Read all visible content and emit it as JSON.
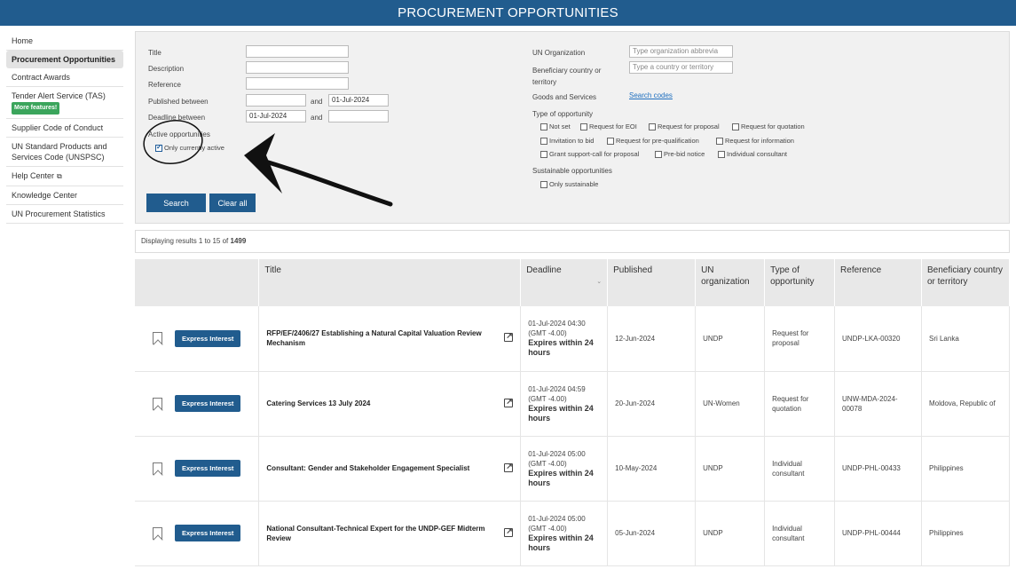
{
  "header": {
    "title": "PROCUREMENT OPPORTUNITIES"
  },
  "sidebar": {
    "items": [
      {
        "label": "Home"
      },
      {
        "label": "Procurement Opportunities"
      },
      {
        "label": "Contract Awards"
      },
      {
        "label": "Tender Alert Service (TAS)",
        "badge": "More features!"
      },
      {
        "label": "Supplier Code of Conduct"
      },
      {
        "label": "UN Standard Products and Services Code (UNSPSC)"
      },
      {
        "label": "Help Center"
      },
      {
        "label": "Knowledge Center"
      },
      {
        "label": "UN Procurement Statistics"
      }
    ]
  },
  "filters": {
    "title_label": "Title",
    "description_label": "Description",
    "reference_label": "Reference",
    "published_label": "Published between",
    "published_and": "and",
    "published_to": "01-Jul-2024",
    "deadline_label": "Deadline between",
    "deadline_from": "01-Jul-2024",
    "deadline_and": "and",
    "active_label": "Active opportunities",
    "active_checkbox": "Only currently active",
    "un_org_label": "UN Organization",
    "un_org_placeholder": "Type organization abbrevia",
    "beneficiary_label": "Beneficiary country or territory",
    "beneficiary_placeholder": "Type a country or territory",
    "goods_label": "Goods and Services",
    "search_codes": "Search codes",
    "type_label": "Type of opportunity",
    "types": {
      "not_set": "Not set",
      "eoi": "Request for EOI",
      "proposal": "Request for proposal",
      "quotation": "Request for quotation",
      "itb": "Invitation to bid",
      "prequal": "Request for pre-qualification",
      "info": "Request for information",
      "grant": "Grant support-call for proposal",
      "prebid": "Pre-bid notice",
      "consultant": "Individual consultant"
    },
    "sustainable_label": "Sustainable opportunities",
    "sustainable_checkbox": "Only sustainable",
    "search_button": "Search",
    "clear_button": "Clear all"
  },
  "results": {
    "prefix": "Displaying results 1 to 15 of",
    "total": "1499"
  },
  "table": {
    "headers": [
      "Title",
      "Deadline",
      "Published",
      "UN organization",
      "Type of opportunity",
      "Reference",
      "Beneficiary country or territory"
    ],
    "express_label": "Express Interest",
    "rows": [
      {
        "title": "RFP/EF/2406/27 Establishing a Natural Capital Valuation Review Mechanism",
        "deadline": "01-Jul-2024 04:30",
        "tz": "(GMT -4.00)",
        "expires": "Expires within 24 hours",
        "published": "12-Jun-2024",
        "org": "UNDP",
        "type": "Request for proposal",
        "reference": "UNDP-LKA-00320",
        "country": "Sri Lanka"
      },
      {
        "title": "Catering Services 13 July 2024",
        "deadline": "01-Jul-2024 04:59",
        "tz": "(GMT -4.00)",
        "expires": "Expires within 24 hours",
        "published": "20-Jun-2024",
        "org": "UN-Women",
        "type": "Request for quotation",
        "reference": "UNW-MDA-2024-00078",
        "country": "Moldova, Republic of"
      },
      {
        "title": "Consultant: Gender and Stakeholder Engagement Specialist",
        "deadline": "01-Jul-2024 05:00",
        "tz": "(GMT -4.00)",
        "expires": "Expires within 24 hours",
        "published": "10-May-2024",
        "org": "UNDP",
        "type": "Individual consultant",
        "reference": "UNDP-PHL-00433",
        "country": "Philippines"
      },
      {
        "title": "National Consultant-Technical Expert for the UNDP-GEF Midterm Review",
        "deadline": "01-Jul-2024 05:00",
        "tz": "(GMT -4.00)",
        "expires": "Expires within 24 hours",
        "published": "05-Jun-2024",
        "org": "UNDP",
        "type": "Individual consultant",
        "reference": "UNDP-PHL-00444",
        "country": "Philippines"
      }
    ]
  }
}
